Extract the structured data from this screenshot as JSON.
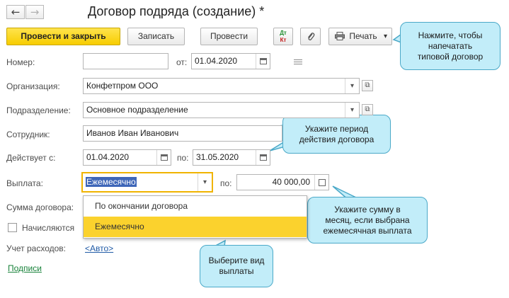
{
  "header": {
    "back_icon": "←",
    "forward_icon": "→",
    "title": "Договор подряда (создание) *"
  },
  "toolbar": {
    "post_and_close": "Провести и закрыть",
    "save": "Записать",
    "post": "Провести",
    "dt_kt_top": "Дт",
    "dt_kt_bottom": "Кт",
    "paperclip_icon": "📎",
    "print_icon": "printer-icon",
    "print_label": "Печать",
    "print_arrow": "▾"
  },
  "form": {
    "number_label": "Номер:",
    "number_value": "",
    "from_label": "от:",
    "from_date": "01.04.2020",
    "org_label": "Организация:",
    "org_value": "Конфетпром ООО",
    "dept_label": "Подразделение:",
    "dept_value": "Основное подразделение",
    "employee_label": "Сотрудник:",
    "employee_value": "Иванов Иван Иванович",
    "valid_label": "Действует с:",
    "valid_from": "01.04.2020",
    "valid_to_label": "по:",
    "valid_to": "31.05.2020",
    "payment_label": "Выплата:",
    "payment_value": "Ежемесячно",
    "payment_amount_label": "по:",
    "payment_amount": "40 000,00",
    "contract_sum_label": "Сумма договора:",
    "accrued_label": "Начисляются",
    "expense_label": "Учет расходов:",
    "expense_link": "<Авто>",
    "signatures_link": "Подписи"
  },
  "dropdown": {
    "options": [
      "По окончании договора",
      "Ежемесячно"
    ],
    "selected_index": 1
  },
  "callouts": {
    "print": "Нажмите, чтобы\nнапечатать\nтиповой договор",
    "period": "Укажите период\nдействия договора",
    "amount": "Укажите сумму в\nмесяц, если выбрана\nежемесячная выплата",
    "type": "Выберите вид\nвыплаты"
  },
  "colors": {
    "primary_button": "#f7cd00",
    "callout_fill": "#c2edf9",
    "callout_border": "#4ba9c8",
    "selection": "#fbd22d",
    "link_blue": "#1f5aa6",
    "link_green": "#18823a",
    "active_field_border": "#f0b400"
  }
}
